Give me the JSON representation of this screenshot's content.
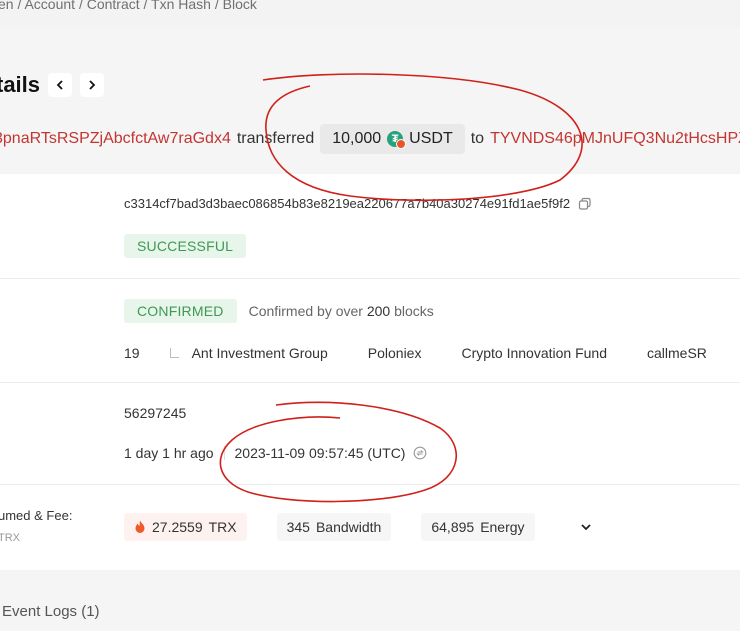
{
  "breadcrumb": "en / Account / Contract / Txn Hash / Block",
  "header": {
    "title": "tails",
    "transfer": {
      "from": "3pnaRTsRSPZjAbcfctAw7raGdx4",
      "verb": "transferred",
      "amount": "10,000",
      "token": "USDT",
      "to_word": "to",
      "to": "TYVNDS46pMJnUFQ3Nu2tHcsHPZ"
    }
  },
  "hash": {
    "value": "c3314cf7bad3d3baec086854b83e8219ea220677a7b40a30274e91fd1ae5f9f2",
    "status": "SUCCESSFUL"
  },
  "confirmation": {
    "badge": "CONFIRMED",
    "text_prefix": "Confirmed by over",
    "count": "200",
    "text_suffix": "blocks",
    "sr_count": "19",
    "srs": [
      "Ant Investment Group",
      "Poloniex",
      "Crypto Innovation Fund",
      "callmeSR"
    ]
  },
  "block": {
    "number": "56297245",
    "age": "1 day 1 hr ago",
    "timestamp": "2023-11-09 09:57:45 (UTC)"
  },
  "resources": {
    "label": "umed & Fee:",
    "label_sub": "TRX",
    "fee_amount": "27.2559",
    "fee_unit": "TRX",
    "bandwidth_amount": "345",
    "bandwidth_label": "Bandwidth",
    "energy_amount": "64,895",
    "energy_label": "Energy"
  },
  "event_logs": "Event Logs (1)",
  "colors": {
    "address_red": "#c23631",
    "success_green": "#3c9a52",
    "annotation_red": "#d0201a"
  }
}
